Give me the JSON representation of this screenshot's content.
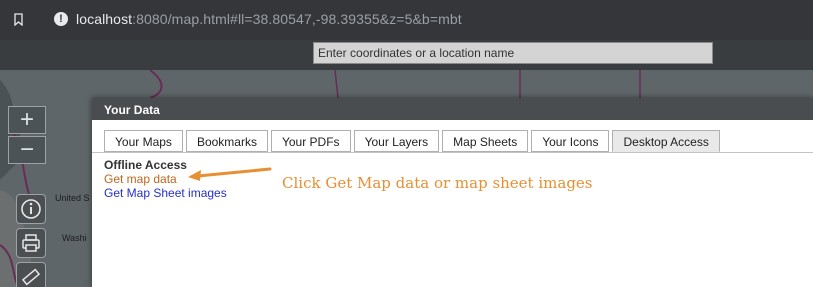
{
  "browser": {
    "url_host": "localhost",
    "url_rest": ":8080/map.html#ll=38.80547,-98.39355&z=5&b=mbt"
  },
  "map": {
    "search": {
      "placeholder": "Enter coordinates or a location name"
    },
    "zoom_in_label": "+",
    "zoom_out_label": "−",
    "labels": [
      "United S",
      "Washi"
    ]
  },
  "dialog": {
    "title": "Your Data",
    "tabs": [
      {
        "label": "Your Maps",
        "active": false
      },
      {
        "label": "Bookmarks",
        "active": false
      },
      {
        "label": "Your PDFs",
        "active": false
      },
      {
        "label": "Your Layers",
        "active": false
      },
      {
        "label": "Map Sheets",
        "active": false
      },
      {
        "label": "Your Icons",
        "active": false
      },
      {
        "label": "Desktop Access",
        "active": true
      }
    ],
    "offline_heading": "Offline Access",
    "get_map_data": "Get map data",
    "get_map_sheet_images": "Get Map Sheet images"
  },
  "annotation": {
    "text": "Click Get Map data or map sheet images",
    "color": "#e88f33"
  },
  "colors": {
    "link_orange": "#c0651e",
    "link_blue": "#2431c4"
  }
}
